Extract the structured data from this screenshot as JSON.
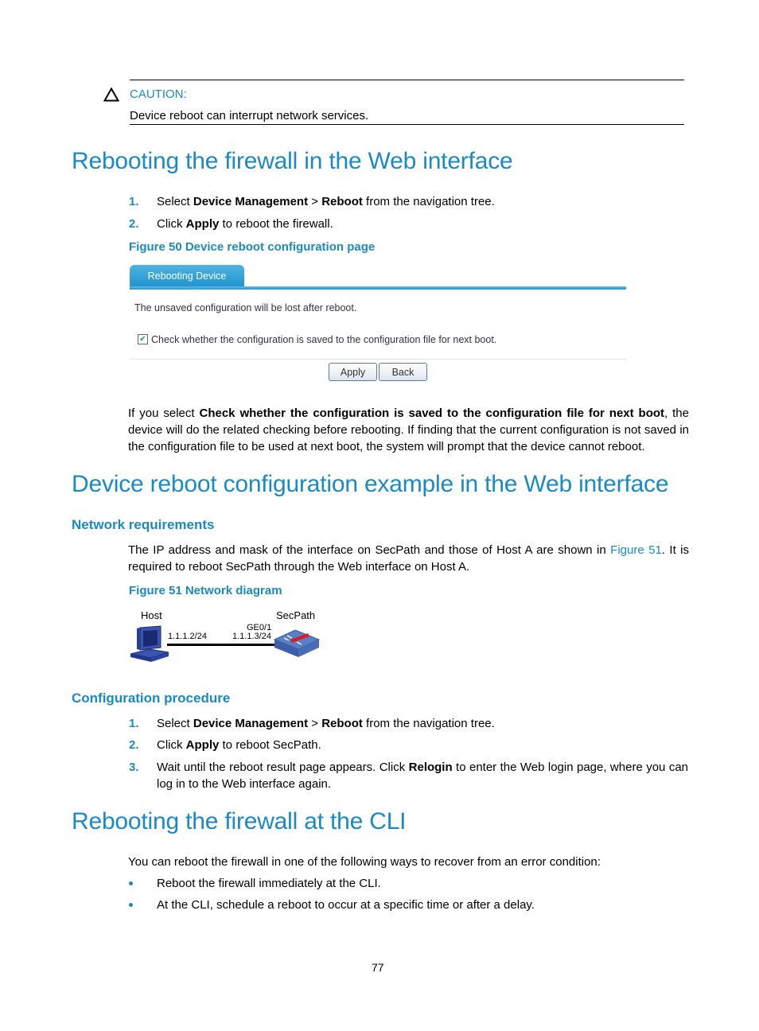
{
  "caution": {
    "label": "CAUTION:",
    "text": "Device reboot can interrupt network services."
  },
  "section1": {
    "title": "Rebooting the firewall in the Web interface",
    "steps": [
      {
        "num": "1.",
        "pre": "Select ",
        "b1": "Device Management",
        "mid": " > ",
        "b2": "Reboot",
        "post": " from the navigation tree."
      },
      {
        "num": "2.",
        "pre": "Click ",
        "b1": "Apply",
        "post": " to reboot the firewall."
      }
    ],
    "figure_caption": "Figure 50 Device reboot configuration page",
    "web_ui": {
      "tab_label": "Rebooting Device",
      "notice": "The unsaved configuration will be lost after reboot.",
      "checkbox_label": "Check whether the configuration is saved to the configuration file for next boot.",
      "checkbox_checked": true,
      "apply_label": "Apply",
      "back_label": "Back"
    },
    "paragraph": {
      "pre": "If you select ",
      "bold": "Check whether the configuration is saved to the configuration file for next boot",
      "post": ", the device will do the related checking before rebooting. If finding that the current configuration is not saved in the configuration file to be used at next boot, the system will prompt that the device cannot reboot."
    }
  },
  "section2": {
    "title": "Device reboot configuration example in the Web interface",
    "network_requirements": {
      "heading": "Network requirements",
      "pre": "The IP address and mask of the interface on SecPath and those of Host A are shown in ",
      "link": "Figure 51",
      "post": ". It is required to reboot SecPath through the Web interface on Host A."
    },
    "figure_caption": "Figure 51 Network diagram",
    "diagram": {
      "host_label": "Host",
      "host_ip": "1.1.1.2/24",
      "secpath_label": "SecPath",
      "secpath_iface": "GE0/1",
      "secpath_ip": "1.1.1.3/24"
    },
    "configuration_procedure": {
      "heading": "Configuration procedure",
      "steps": [
        {
          "num": "1.",
          "pre": "Select ",
          "b1": "Device Management",
          "mid": " > ",
          "b2": "Reboot",
          "post": " from the navigation tree."
        },
        {
          "num": "2.",
          "pre": "Click ",
          "b1": "Apply",
          "post": " to reboot SecPath."
        },
        {
          "num": "3.",
          "pre": "Wait until the reboot result page appears. Click ",
          "b1": "Relogin",
          "post": " to enter the Web login page, where you can log in to the Web interface again."
        }
      ]
    }
  },
  "section3": {
    "title": "Rebooting the firewall at the CLI",
    "intro": "You can reboot the firewall in one of the following ways to recover from an error condition:",
    "bullets": [
      "Reboot the firewall immediately at the CLI.",
      "At the CLI, schedule a reboot to occur at a specific time or after a delay."
    ]
  },
  "page_number": "77"
}
